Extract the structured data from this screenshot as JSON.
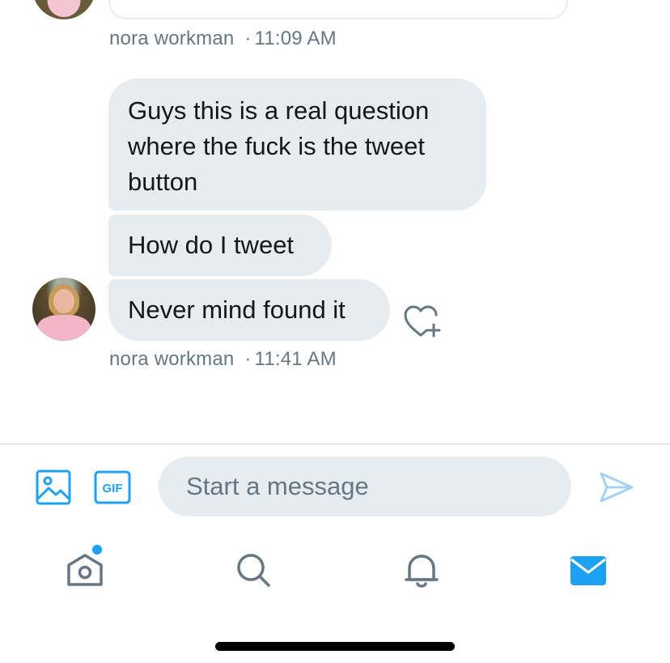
{
  "conversation": {
    "earlier_meta": {
      "sender": "nora workman",
      "separator": "·",
      "time": "11:09 AM"
    },
    "messages": [
      {
        "text": "Guys this is a real question where the fuck is the tweet button"
      },
      {
        "text": "How do I tweet"
      },
      {
        "text": "Never mind found it"
      }
    ],
    "latest_meta": {
      "sender": "nora workman",
      "separator": "·",
      "time": "11:41 AM"
    }
  },
  "composer": {
    "placeholder": "Start a message",
    "gif_label": "GIF",
    "icons": [
      "image-icon",
      "gif-icon",
      "send-icon"
    ]
  },
  "tab_bar": {
    "items": [
      {
        "name": "home",
        "icon": "home-icon",
        "has_notification_dot": true
      },
      {
        "name": "search",
        "icon": "search-icon"
      },
      {
        "name": "notifications",
        "icon": "bell-icon"
      },
      {
        "name": "messages",
        "icon": "envelope-icon",
        "active": true
      }
    ]
  },
  "colors": {
    "accent": "#1da1f2",
    "bubble_bg": "#e6ecf0",
    "muted_text": "#657786",
    "inactive_icon": "#657786",
    "active_icon": "#1da1f2"
  }
}
